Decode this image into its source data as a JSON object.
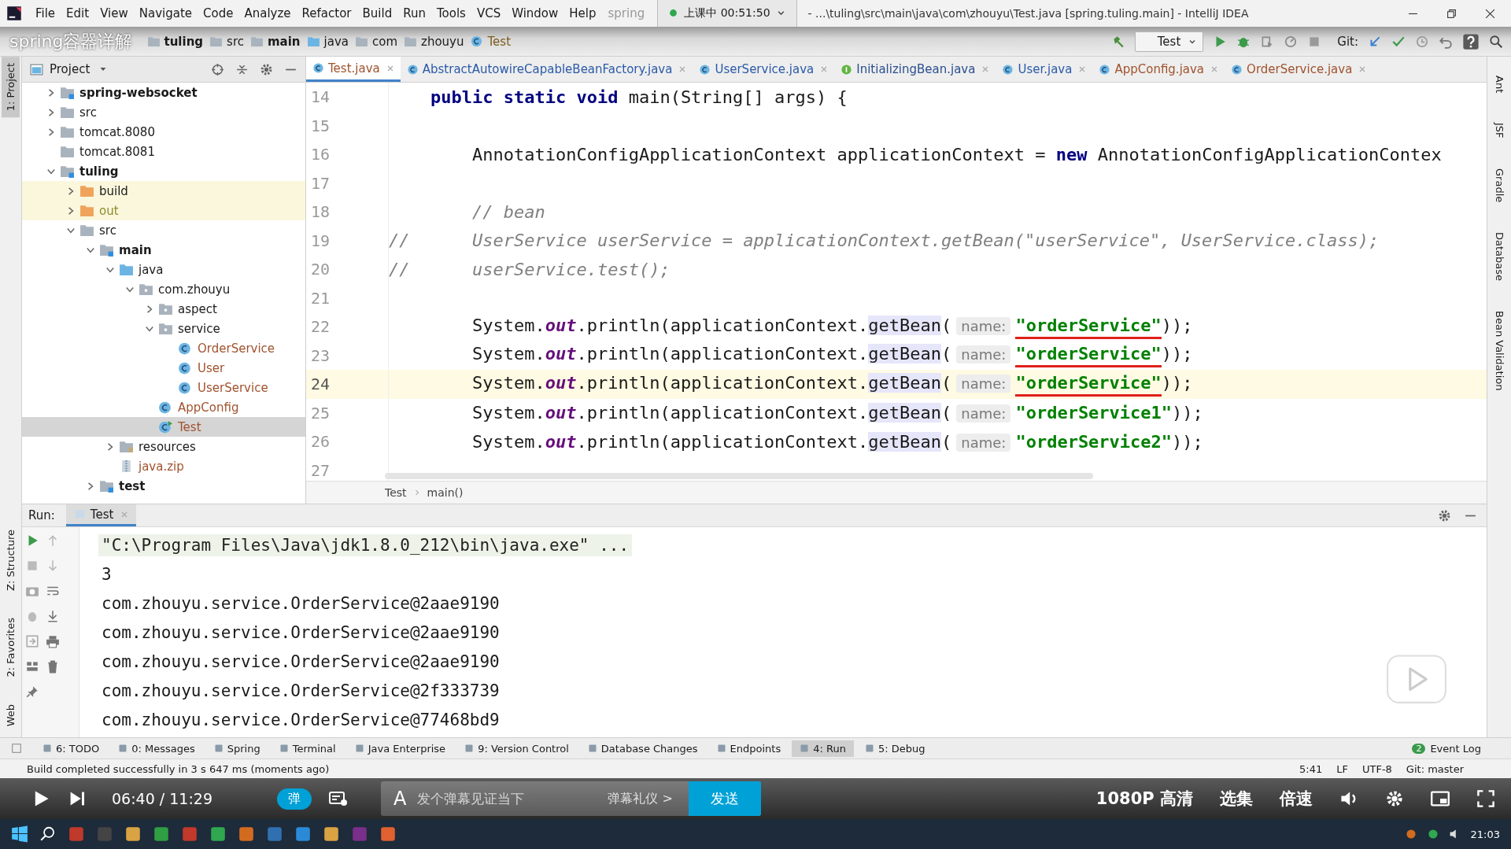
{
  "window": {
    "title": "- ...\\tuling\\src\\main\\java\\com\\zhouyu\\Test.java [spring.tuling.main] - IntelliJ IDEA",
    "title_fragment": "spring"
  },
  "menu": [
    "File",
    "Edit",
    "View",
    "Navigate",
    "Code",
    "Analyze",
    "Refactor",
    "Build",
    "Run",
    "Tools",
    "VCS",
    "Window",
    "Help"
  ],
  "recording": {
    "label": "上课中 00:51:50"
  },
  "video_title": "spring容器详解",
  "breadcrumbs": [
    "tuling",
    "src",
    "main",
    "java",
    "com",
    "zhouyu",
    "Test"
  ],
  "run_config": "Test",
  "git_label": "Git:",
  "left_stripe": [
    "1: Project",
    "Z: Structure",
    "2: Favorites",
    "Web"
  ],
  "right_stripe": [
    "Ant",
    "JSF",
    "Gradle",
    "Database",
    "Bean Validation"
  ],
  "project": {
    "title": "Project",
    "tree": [
      {
        "label": "spring-websocket",
        "kind": "module",
        "bold": true,
        "expanded": false,
        "selected": false
      },
      {
        "label": "src",
        "kind": "folder",
        "bold": false,
        "expanded": false,
        "selected": false
      },
      {
        "label": "tomcat.8080",
        "kind": "folder",
        "bold": false,
        "expanded": false,
        "selected": false
      },
      {
        "label": "tomcat.8081",
        "kind": "folder",
        "bold": false,
        "selected": false
      },
      {
        "label": "tuling",
        "kind": "module",
        "bold": true,
        "expanded": true,
        "selected": false,
        "children": [
          {
            "label": "build",
            "kind": "excluded",
            "bold": false,
            "expanded": false,
            "selected": false
          },
          {
            "label": "out",
            "kind": "excluded",
            "bold": false,
            "expanded": false,
            "selected": false
          },
          {
            "label": "src",
            "kind": "folder",
            "bold": false,
            "expanded": true,
            "selected": false,
            "children": [
              {
                "label": "main",
                "kind": "module",
                "bold": true,
                "expanded": true,
                "selected": false,
                "children": [
                  {
                    "label": "java",
                    "kind": "source",
                    "bold": false,
                    "expanded": true,
                    "selected": false,
                    "children": [
                      {
                        "label": "com.zhouyu",
                        "kind": "package",
                        "bold": false,
                        "expanded": true,
                        "selected": false,
                        "children": [
                          {
                            "label": "aspect",
                            "kind": "package",
                            "bold": false,
                            "expanded": false,
                            "selected": false
                          },
                          {
                            "label": "service",
                            "kind": "package",
                            "bold": false,
                            "expanded": true,
                            "selected": false,
                            "children": [
                              {
                                "label": "OrderService",
                                "kind": "class",
                                "bold": false,
                                "selected": false
                              },
                              {
                                "label": "User",
                                "kind": "class",
                                "bold": false,
                                "selected": false
                              },
                              {
                                "label": "UserService",
                                "kind": "class",
                                "bold": false,
                                "selected": false
                              }
                            ]
                          },
                          {
                            "label": "AppConfig",
                            "kind": "class",
                            "bold": false,
                            "selected": false
                          },
                          {
                            "label": "Test",
                            "kind": "class",
                            "bold": false,
                            "selected": true
                          }
                        ]
                      }
                    ]
                  },
                  {
                    "label": "resources",
                    "kind": "resources",
                    "bold": false,
                    "expanded": false,
                    "selected": false
                  },
                  {
                    "label": "java.zip",
                    "kind": "zip",
                    "bold": false,
                    "selected": false
                  }
                ]
              },
              {
                "label": "test",
                "kind": "module",
                "bold": true,
                "expanded": false,
                "selected": false
              }
            ]
          }
        ]
      }
    ]
  },
  "editor": {
    "tabs": [
      {
        "label": "Test.java",
        "kind": "class",
        "selected": true
      },
      {
        "label": "AbstractAutowireCapableBeanFactory.java",
        "kind": "class",
        "selected": false
      },
      {
        "label": "UserService.java",
        "kind": "class",
        "selected": false
      },
      {
        "label": "InitializingBean.java",
        "kind": "interface",
        "selected": false
      },
      {
        "label": "User.java",
        "kind": "class",
        "selected": false
      },
      {
        "label": "AppConfig.java",
        "kind": "class",
        "selected": false
      },
      {
        "label": "OrderService.java",
        "kind": "class",
        "selected": false
      }
    ],
    "lines": [
      {
        "number": "14",
        "current": false,
        "tokens": [
          {
            "text": "    public static void",
            "kind": "kw"
          },
          {
            "text": " main(String[] args) {",
            "kind": "plain"
          }
        ]
      },
      {
        "number": "15",
        "current": false
      },
      {
        "number": "16",
        "current": false,
        "tokens": [
          {
            "text": "        AnnotationConfigApplicationContext applicationContext = ",
            "kind": "plain"
          },
          {
            "text": "new",
            "kind": "kw"
          },
          {
            "text": " AnnotationConfigApplicationContex",
            "kind": "plain"
          }
        ]
      },
      {
        "number": "17",
        "current": false
      },
      {
        "number": "18",
        "current": false,
        "tokens": [
          {
            "text": "        // bean",
            "kind": "comment"
          }
        ]
      },
      {
        "number": "19",
        "current": false,
        "tokens": [
          {
            "text": "//      UserService userService = applicationContext.getBean(\"userService\", UserService.class);",
            "kind": "comment"
          }
        ]
      },
      {
        "number": "20",
        "current": false,
        "tokens": [
          {
            "text": "//      userService.test();",
            "kind": "comment"
          }
        ]
      },
      {
        "number": "21",
        "current": false
      },
      {
        "number": "22",
        "current": false,
        "tokens": [
          {
            "text": "        System.",
            "kind": "plain"
          },
          {
            "text": "out",
            "kind": "field"
          },
          {
            "text": ".println(applicationContext.",
            "kind": "plain"
          },
          {
            "text": "getBean",
            "kind": "call"
          },
          {
            "text": "(",
            "kind": "plain"
          },
          {
            "text": "name:",
            "kind": "hint"
          },
          {
            "text": "\"orderService\"",
            "kind": "str",
            "pen": true
          },
          {
            "text": "));",
            "kind": "plain"
          }
        ]
      },
      {
        "number": "23",
        "current": false,
        "tokens": [
          {
            "text": "        System.",
            "kind": "plain"
          },
          {
            "text": "out",
            "kind": "field"
          },
          {
            "text": ".println(applicationContext.",
            "kind": "plain"
          },
          {
            "text": "getBean",
            "kind": "call"
          },
          {
            "text": "(",
            "kind": "plain"
          },
          {
            "text": "name:",
            "kind": "hint"
          },
          {
            "text": "\"orderService\"",
            "kind": "str",
            "pen": true
          },
          {
            "text": "));",
            "kind": "plain"
          }
        ]
      },
      {
        "number": "24",
        "current": true,
        "tokens": [
          {
            "text": "        System.",
            "kind": "plain"
          },
          {
            "text": "out",
            "kind": "field"
          },
          {
            "text": ".println(applicationContext.",
            "kind": "plain"
          },
          {
            "text": "getBean",
            "kind": "call"
          },
          {
            "text": "(",
            "kind": "plain"
          },
          {
            "text": "name:",
            "kind": "hint"
          },
          {
            "text": "\"orderService\"",
            "kind": "str",
            "pen": true
          },
          {
            "text": "));",
            "kind": "plain"
          }
        ]
      },
      {
        "number": "25",
        "current": false,
        "tokens": [
          {
            "text": "        System.",
            "kind": "plain"
          },
          {
            "text": "out",
            "kind": "field"
          },
          {
            "text": ".println(applicationContext.",
            "kind": "plain"
          },
          {
            "text": "getBean",
            "kind": "call"
          },
          {
            "text": "(",
            "kind": "plain"
          },
          {
            "text": "name:",
            "kind": "hint"
          },
          {
            "text": "\"orderService1\"",
            "kind": "str",
            "pen": false
          },
          {
            "text": "));",
            "kind": "plain"
          }
        ]
      },
      {
        "number": "26",
        "current": false,
        "tokens": [
          {
            "text": "        System.",
            "kind": "plain"
          },
          {
            "text": "out",
            "kind": "field"
          },
          {
            "text": ".println(applicationContext.",
            "kind": "plain"
          },
          {
            "text": "getBean",
            "kind": "call"
          },
          {
            "text": "(",
            "kind": "plain"
          },
          {
            "text": "name:",
            "kind": "hint"
          },
          {
            "text": "\"orderService2\"",
            "kind": "str",
            "pen": false
          },
          {
            "text": "));",
            "kind": "plain"
          }
        ]
      },
      {
        "number": "27",
        "current": false
      }
    ],
    "footer": [
      "Test",
      "main()"
    ]
  },
  "run": {
    "label": "Run:",
    "tab": "Test",
    "console": [
      {
        "text": "\"C:\\Program Files\\Java\\jdk1.8.0_212\\bin\\java.exe\" ...",
        "kind": "command"
      },
      {
        "text": "3",
        "kind": "out"
      },
      {
        "text": "com.zhouyu.service.OrderService@2aae9190",
        "kind": "out"
      },
      {
        "text": "com.zhouyu.service.OrderService@2aae9190",
        "kind": "out"
      },
      {
        "text": "com.zhouyu.service.OrderService@2aae9190",
        "kind": "out"
      },
      {
        "text": "com.zhouyu.service.OrderService@2f333739",
        "kind": "out"
      },
      {
        "text": "com.zhouyu.service.OrderService@77468bd9",
        "kind": "out"
      }
    ]
  },
  "tool_tabs": [
    {
      "label": "6: TODO",
      "selected": false
    },
    {
      "label": "0: Messages",
      "selected": false
    },
    {
      "label": "Spring",
      "selected": false
    },
    {
      "label": "Terminal",
      "selected": false
    },
    {
      "label": "Java Enterprise",
      "selected": false
    },
    {
      "label": "9: Version Control",
      "selected": false
    },
    {
      "label": "Database Changes",
      "selected": false
    },
    {
      "label": "Endpoints",
      "selected": false
    },
    {
      "label": "4: Run",
      "selected": true
    },
    {
      "label": "5: Debug",
      "selected": false
    }
  ],
  "event_log": {
    "label": "Event Log",
    "count": "2"
  },
  "status": {
    "message": "Build completed successfully in 3 s 647 ms (moments ago)",
    "items": [
      "5:41",
      "LF",
      "UTF-8",
      "Git: master"
    ]
  },
  "video": {
    "time": "06:40 / 11:29",
    "danmaku_toggle": "弹",
    "font_button": "A",
    "placeholder": "发个弹幕见证当下",
    "etiquette": "弹幕礼仪 >",
    "send": "发送",
    "quality": "1080P 高清",
    "episodes": "选集",
    "speed": "倍速"
  },
  "taskbar": {
    "clock": "21:03"
  }
}
